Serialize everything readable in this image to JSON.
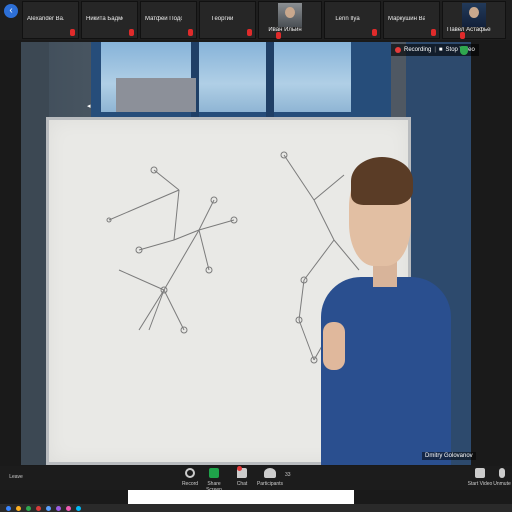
{
  "thumbnails": [
    {
      "name": "Alexander Ва...",
      "has_picture": false
    },
    {
      "name": "Никита Бадмо...",
      "has_picture": false
    },
    {
      "name": "Матфей Подоп",
      "has_picture": false
    },
    {
      "name": "Георгий",
      "has_picture": false
    },
    {
      "name": "Иван Ильин",
      "has_picture": true
    },
    {
      "name": "Lerin Ilya",
      "has_picture": false
    },
    {
      "name": "Маркушин Ва...",
      "has_picture": false
    },
    {
      "name": "Павел Астафьев",
      "has_picture": true,
      "selfie": true
    }
  ],
  "video": {
    "recording_label": "Recording",
    "stop_video_label": "Stop Video",
    "speaker_name": "Dmitry Golovanov"
  },
  "toolbar": {
    "end_label": "Leave",
    "record_label": "Record",
    "share_label": "Share Screen",
    "chat_label": "Chat",
    "participants_label": "Participants",
    "participants_count": "33",
    "video_label": "Start Video",
    "mute_label": "Unmute"
  },
  "colors": {
    "accent": "#2d6fd6",
    "mic_muted": "#e02b2b",
    "share_green": "#1fa34a",
    "sweater": "#2a4f8f"
  }
}
